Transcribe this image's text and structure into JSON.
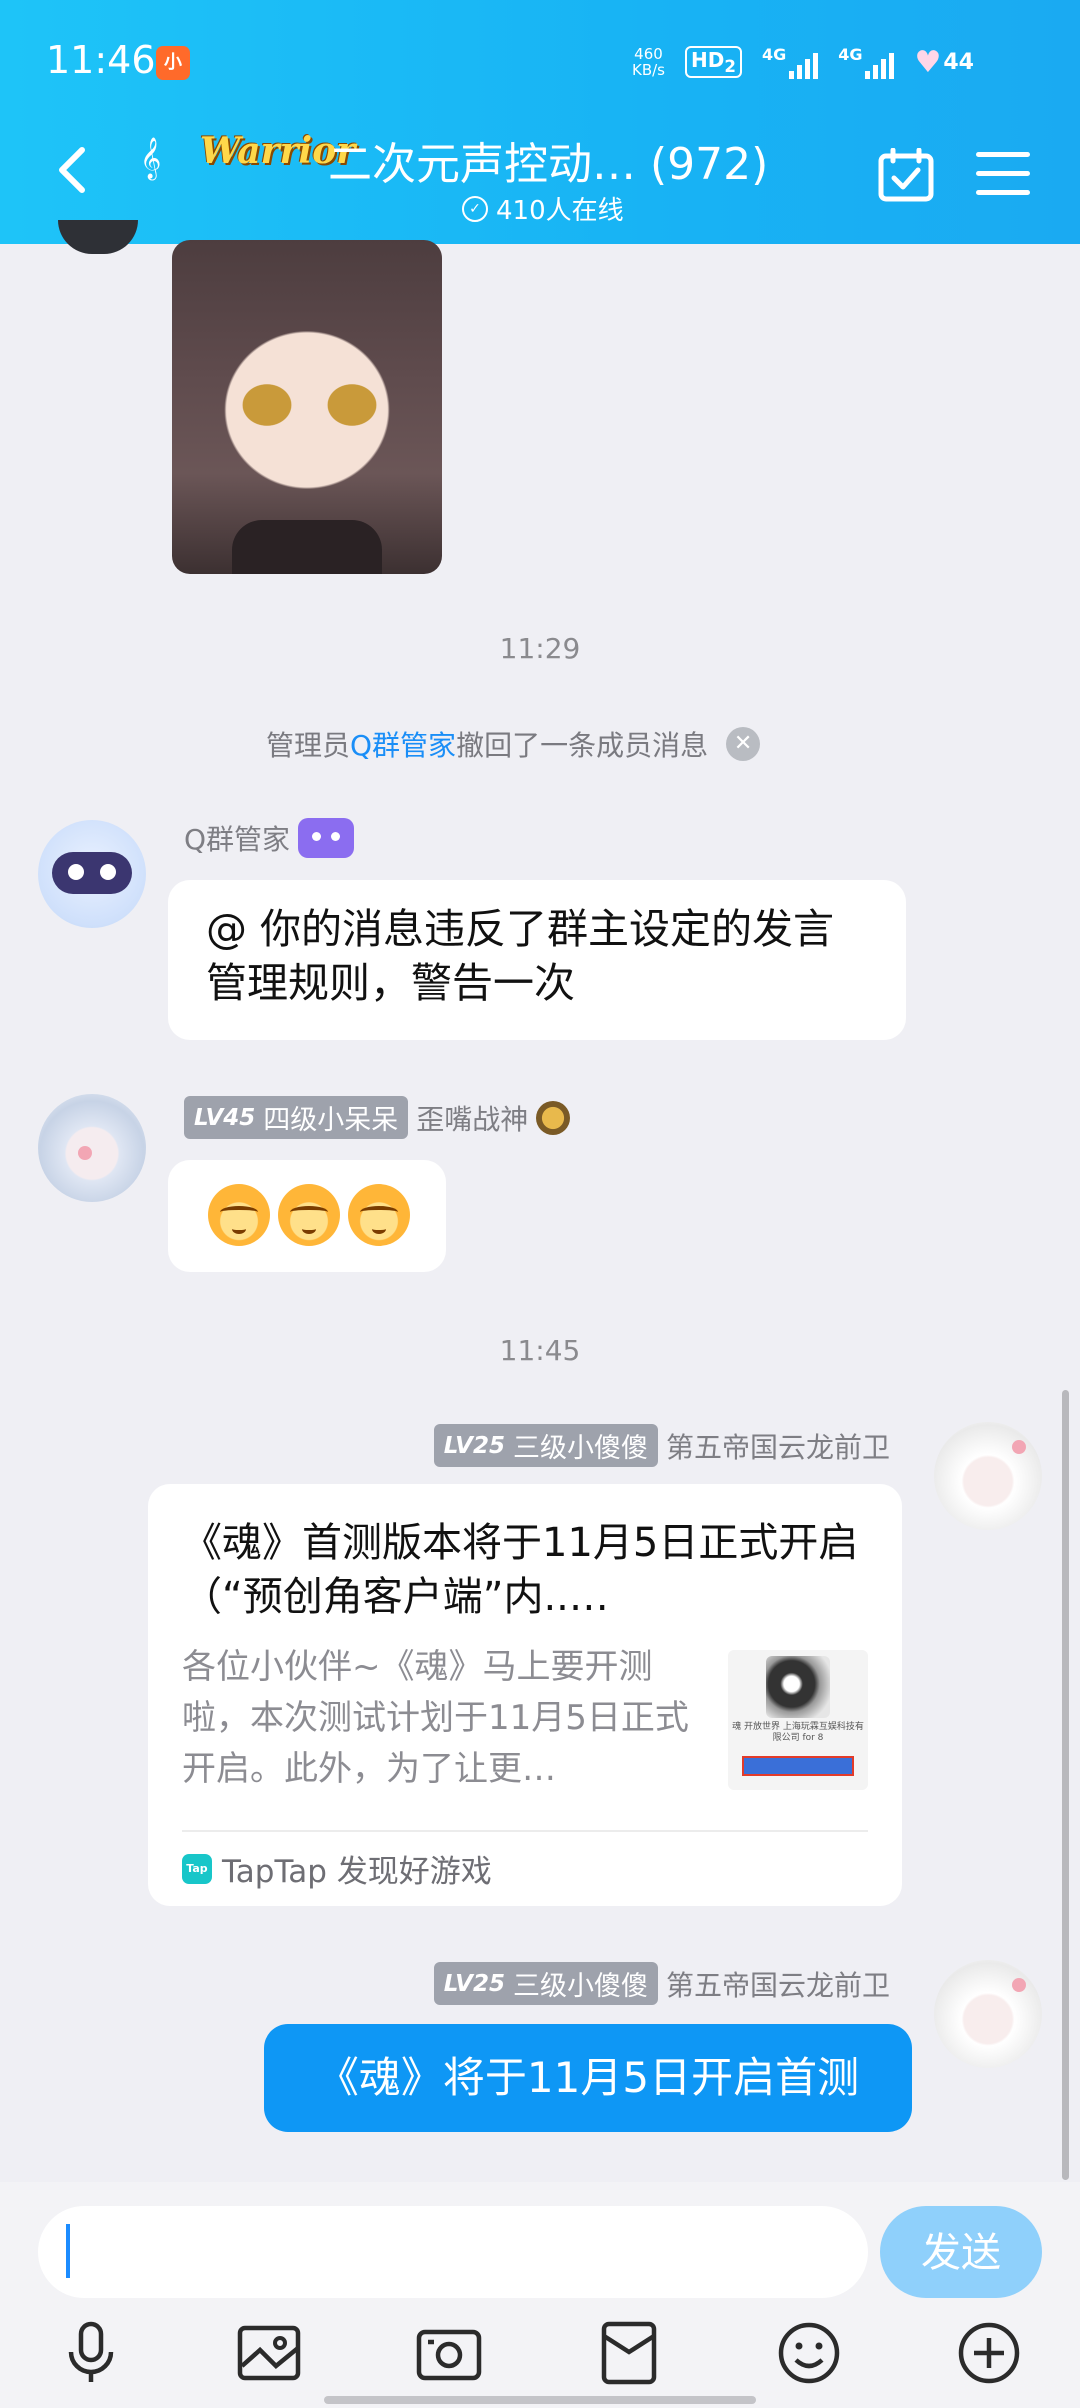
{
  "status_bar": {
    "time": "11:46",
    "app_badge": "小",
    "net_speed": "460",
    "net_unit": "KB/s",
    "hd": "HD",
    "hd_sub": "2",
    "sim1": "4G",
    "sim2": "4G",
    "battery": "44"
  },
  "header": {
    "group_logo": "Warrior",
    "group_title": "二次元声控动… (972)",
    "online": "410人在线"
  },
  "chat": {
    "time_1": "11:29",
    "recall": {
      "prefix": "管理员",
      "name": "Q群管家",
      "suffix": "撤回了一条成员消息"
    },
    "bot_message": {
      "sender": "Q群管家",
      "text": "@ 你的消息违反了群主设定的发言管理规则，警告一次"
    },
    "msg_emoji": {
      "level": "LV45",
      "title": "四级小呆呆",
      "name": "歪嘴战神"
    },
    "time_2": "11:45",
    "share_card": {
      "level": "LV25",
      "title": "三级小傻傻",
      "name": "第五帝国云龙前卫",
      "card_title": "《魂》首测版本将于11月5日正式开启（“预创角客户端”内..…",
      "card_desc": "各位小伙伴~《魂》马上要开测啦，本次测试计划于11月5日正式开启。此外，为了让更…",
      "thumb_text": "魂 开放世界 上海玩霖互娱科技有限公司 for 8",
      "source_logo": "Tap",
      "source": "TapTap 发现好游戏"
    },
    "own_message": {
      "level": "LV25",
      "title": "三级小傻傻",
      "name": "第五帝国云龙前卫",
      "text": "《魂》将于11月5日开启首测"
    }
  },
  "input": {
    "value": "",
    "send_label": "发送"
  },
  "toolbar": [
    "microphone-icon",
    "picture-icon",
    "camera-icon",
    "red-packet-icon",
    "emoji-icon",
    "plus-icon"
  ]
}
